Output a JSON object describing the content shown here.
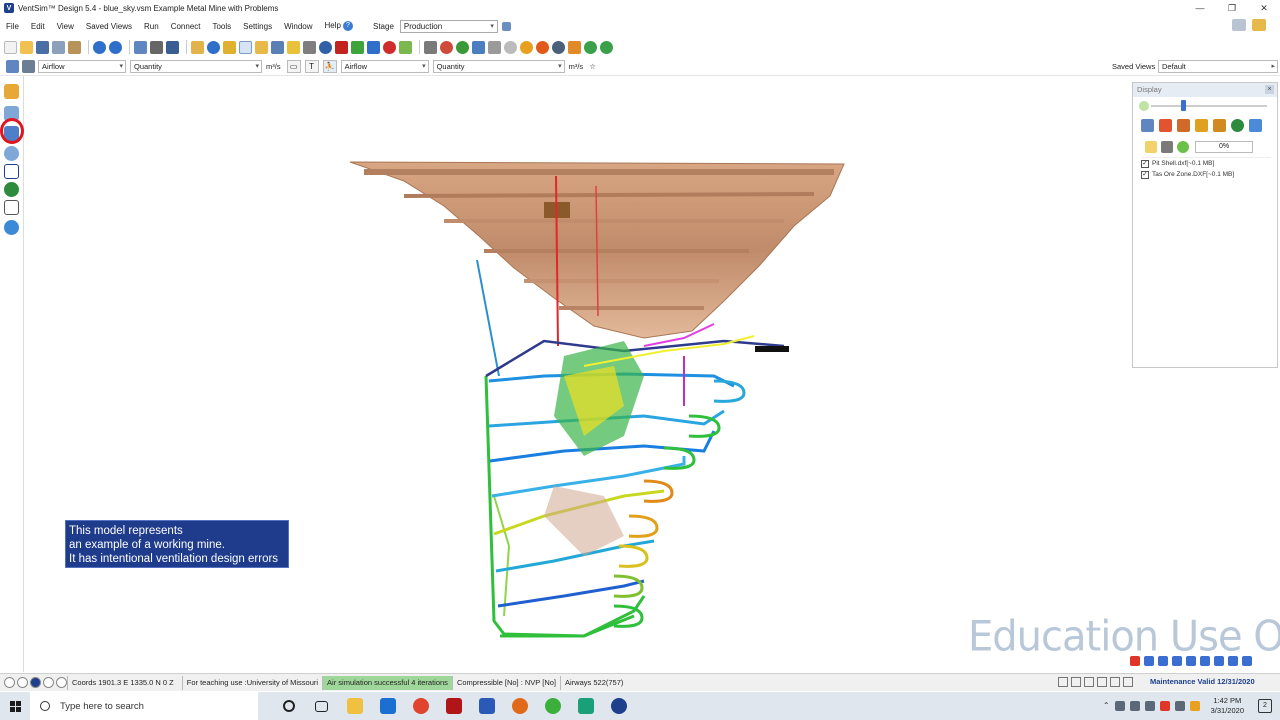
{
  "window": {
    "title": "VentSim™ Design 5.4  -  blue_sky.vsm   Example Metal Mine with Problems",
    "controls": [
      "—",
      "❐",
      "✕"
    ]
  },
  "menu": {
    "items": [
      "File",
      "Edit",
      "View",
      "Saved Views",
      "Run",
      "Connect",
      "Tools",
      "Settings",
      "Window",
      "Help"
    ],
    "help_badge": "?",
    "stage_label": "Stage",
    "stage_value": "Production"
  },
  "toolbar2": {
    "combo1": "Airflow",
    "combo2": "Quantity",
    "unit1": "m³/s",
    "text_btn": "T",
    "combo3": "Airflow",
    "combo4": "Quantity",
    "unit2": "m³/s",
    "star": "☆",
    "saved_views_label": "Saved Views",
    "saved_views_value": "Default"
  },
  "display_panel": {
    "title": "Display",
    "close": "×",
    "percent": "0%",
    "layers": [
      {
        "name": "Pit Shell.dxf[~0.1 MB]",
        "checked": true
      },
      {
        "name": "Tas Ore Zone.DXF[~0.1 MB]",
        "checked": true
      }
    ]
  },
  "info_box": {
    "line1": "This model represents",
    "line2": "an example of a working mine.",
    "line3": "It has intentional ventilation design errors"
  },
  "watermark": "Education Use Only",
  "statusbar": {
    "coords": "Coords 1901.3 E   1335.0 N   0 Z",
    "teaching": "For teaching use :University of Missouri",
    "simulation": "Air simulation successful 4 iterations",
    "compressible": "Compressible [No] : NVP [No]",
    "airways": "Airways 522(757)",
    "maintenance": "Maintenance Valid 12/31/2020"
  },
  "taskbar": {
    "search_placeholder": "Type here to search",
    "time": "1:42 PM",
    "date": "3/31/2020",
    "notifications": "2"
  },
  "colors": {
    "pit_shell": "#c89473",
    "info_box_bg": "#1e3b8c",
    "status_green": "#9fd79a",
    "watermark": "#b9c8d8"
  }
}
